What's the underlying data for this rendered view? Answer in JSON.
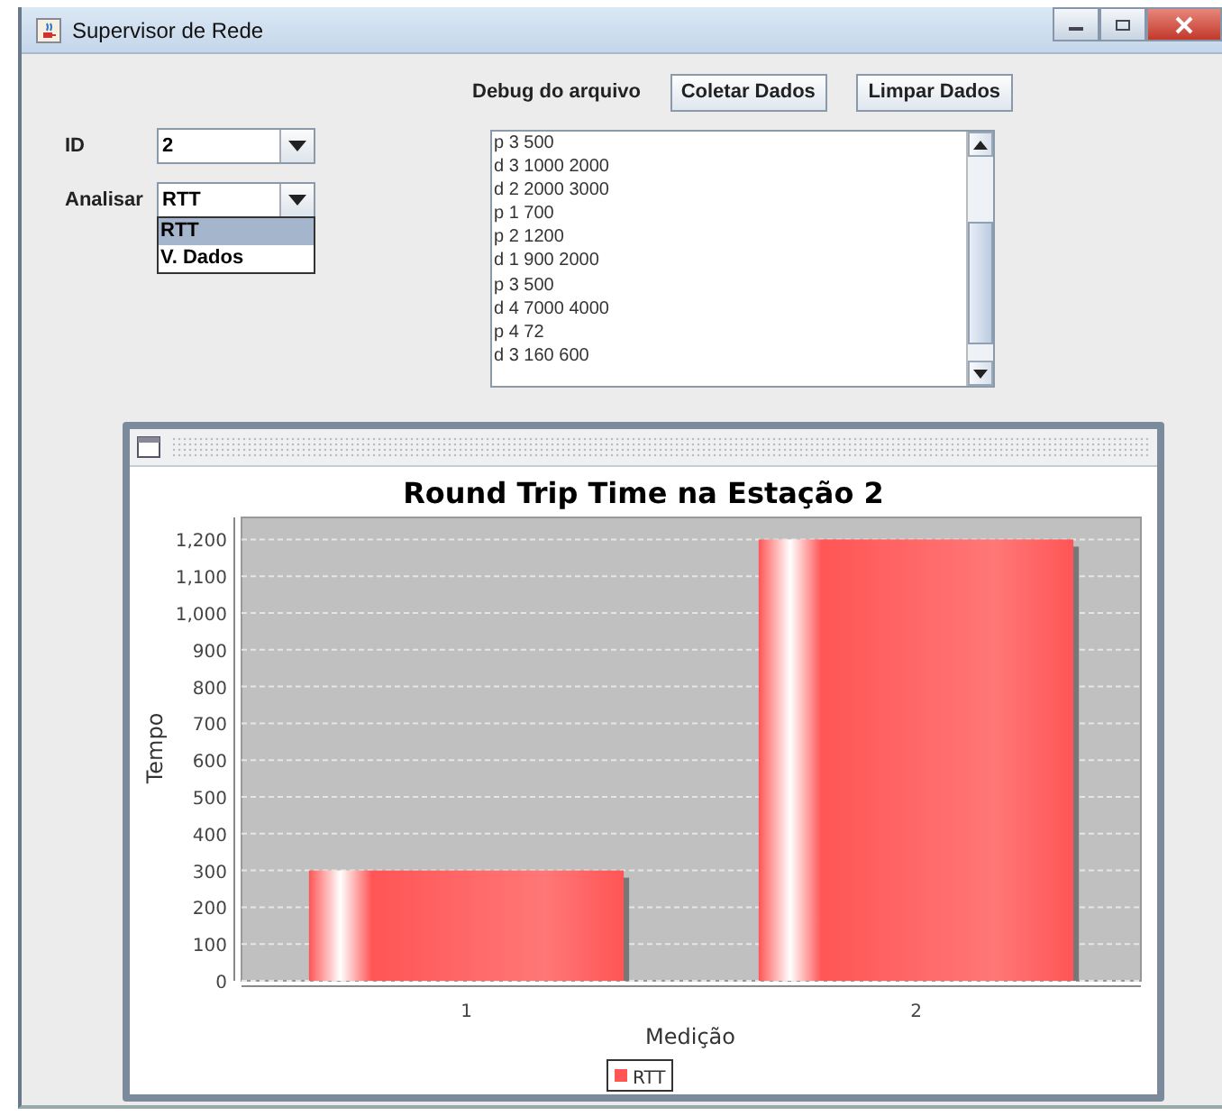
{
  "window": {
    "title": "Supervisor de Rede"
  },
  "form": {
    "id_label": "ID",
    "id_value": "2",
    "analyze_label": "Analisar",
    "analyze_value": "RTT",
    "analyze_options": [
      {
        "label": "RTT",
        "selected": true
      },
      {
        "label": "V. Dados",
        "selected": false
      }
    ]
  },
  "debug": {
    "label": "Debug do arquivo",
    "buttons": [
      "Coletar Dados",
      "Limpar Dados"
    ],
    "lines": [
      "p 3 500",
      "d 3 1000 2000",
      "d 2 2000 3000",
      "p 1 700",
      "p 2 1200",
      "d 1 900 2000",
      "p 3 500",
      "d 4 7000 4000",
      "p 4 72",
      "d 3 160 600"
    ]
  },
  "chart": {
    "chart_data": {
      "type": "bar",
      "title": "Round Trip Time na Estação 2",
      "xlabel": "Medição",
      "ylabel": "Tempo",
      "categories": [
        "1",
        "2"
      ],
      "series": [
        {
          "name": "RTT",
          "color": "#ff5555",
          "values": [
            300,
            1200
          ]
        }
      ],
      "ylim": [
        0,
        1250
      ],
      "grid": true,
      "yticks": [
        {
          "value": 0,
          "label": "0"
        },
        {
          "value": 100,
          "label": "100"
        },
        {
          "value": 200,
          "label": "200"
        },
        {
          "value": 300,
          "label": "300"
        },
        {
          "value": 400,
          "label": "400"
        },
        {
          "value": 500,
          "label": "500"
        },
        {
          "value": 600,
          "label": "600"
        },
        {
          "value": 700,
          "label": "700"
        },
        {
          "value": 800,
          "label": "800"
        },
        {
          "value": 900,
          "label": "900"
        },
        {
          "value": 1000,
          "label": "1,000"
        },
        {
          "value": 1100,
          "label": "1,100"
        },
        {
          "value": 1200,
          "label": "1,200"
        }
      ]
    }
  }
}
